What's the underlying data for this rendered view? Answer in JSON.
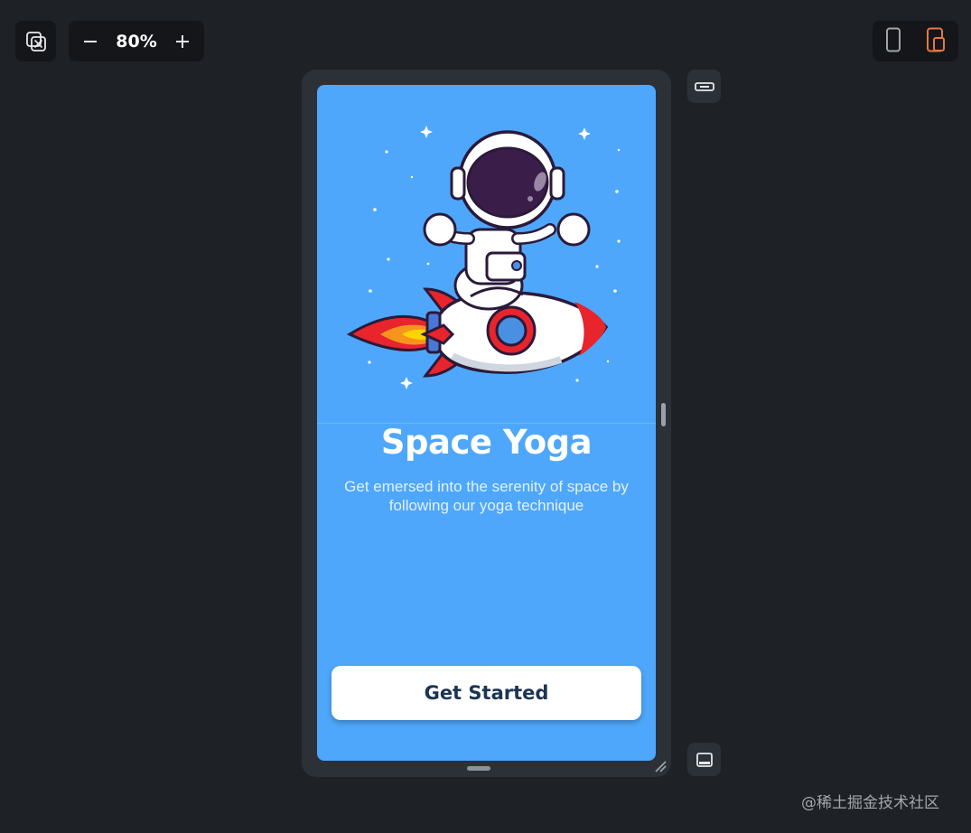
{
  "toolbar": {
    "fit_icon": "fit-screen-icon",
    "zoom_out_icon": "minus-icon",
    "zoom_value": "80%",
    "zoom_in_icon": "plus-icon"
  },
  "device_toggle": {
    "icons": [
      "phone-icon",
      "phone-tablet-icon"
    ],
    "active_color": "#e07a45"
  },
  "side_controls": {
    "keyboard_icon": "keyboard-icon",
    "navbar_icon": "navigation-bar-icon"
  },
  "app": {
    "background": "#4ea7fa",
    "title": "Space Yoga",
    "subtitle": "Get emersed into the serenity of space by following our yoga technique",
    "cta_label": "Get Started"
  },
  "watermark": "@稀土掘金技术社区"
}
